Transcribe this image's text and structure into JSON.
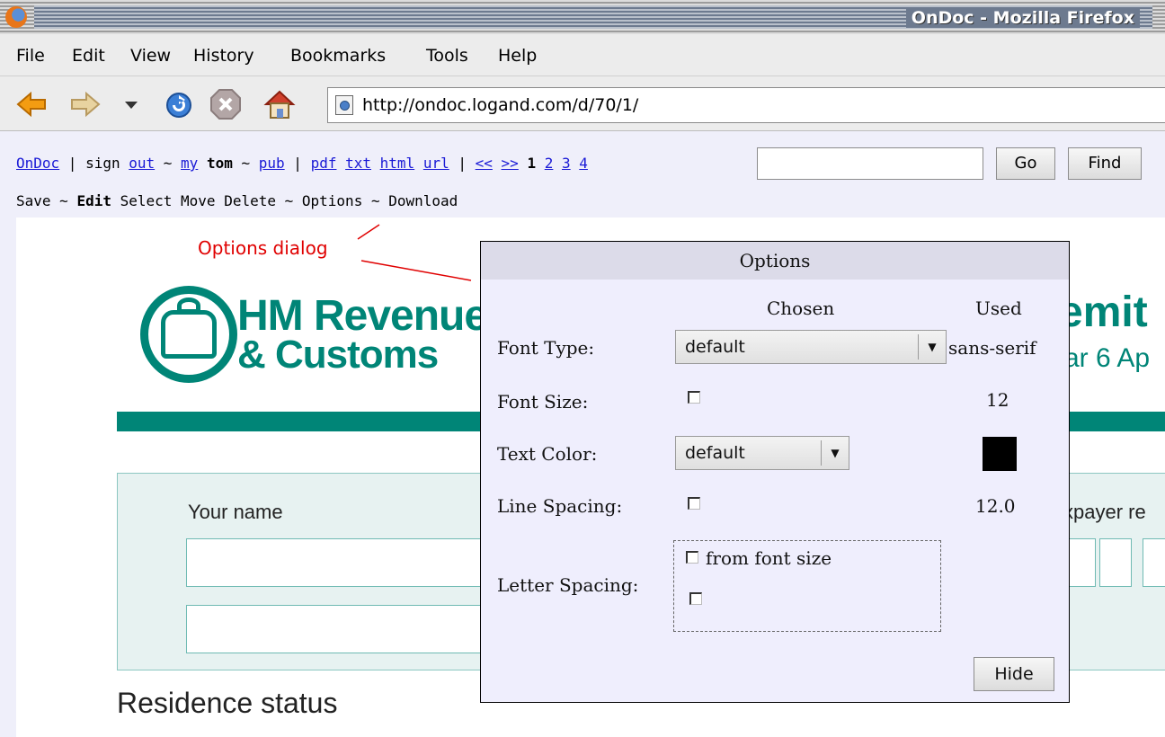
{
  "window": {
    "title": "OnDoc - Mozilla Firefox"
  },
  "menubar": {
    "items": [
      "File",
      "Edit",
      "View",
      "History",
      "Bookmarks",
      "Tools",
      "Help"
    ]
  },
  "navbar": {
    "url": "http://ondoc.logand.com/d/70/1/"
  },
  "toolbar": {
    "ondoc": "OnDoc",
    "sep1": " | sign ",
    "out": "out",
    "t1": " ~ ",
    "my": "my",
    "user": " tom ",
    "t2": "~ ",
    "pub": "pub",
    "sep2": " | ",
    "pdf": "pdf",
    "txt": "txt",
    "html": "html",
    "url": "url",
    "sep3": " | ",
    "prev": "<<",
    "next": ">>",
    "page_current": "1",
    "page2": "2",
    "page3": "3",
    "page4": "4",
    "go_label": "Go",
    "find_label": "Find",
    "find_value": ""
  },
  "toolbar2": {
    "save": "Save ~ ",
    "edit": "Edit",
    "rest": " Select Move Delete ~ Options ~ Download"
  },
  "document": {
    "org_line1": "HM Revenue",
    "org_line2": "& Customs",
    "title_fragment": "emit",
    "subtitle_fragment": "ar 6 Ap",
    "your_name_label": "Your name",
    "taxpayer_fragment": "xpayer re",
    "residence_heading": "Residence status"
  },
  "annotation": {
    "text": "Options dialog",
    "color": "#e00000"
  },
  "options_dialog": {
    "title": "Options",
    "col_chosen": "Chosen",
    "col_used": "Used",
    "font_type": {
      "label": "Font Type:",
      "chosen": "default",
      "used": "sans-serif"
    },
    "font_size": {
      "label": "Font Size:",
      "used": "12"
    },
    "text_color": {
      "label": "Text Color:",
      "chosen": "default",
      "used_color": "#000000"
    },
    "line_spacing": {
      "label": "Line Spacing:",
      "used": "12.0"
    },
    "letter_spacing": {
      "label": "Letter Spacing:",
      "from_font_size": "from font size"
    },
    "hide_label": "Hide"
  },
  "colors": {
    "hmrc_green": "#008577",
    "page_bg": "#efeffa",
    "dialog_bg": "#efeefd"
  }
}
